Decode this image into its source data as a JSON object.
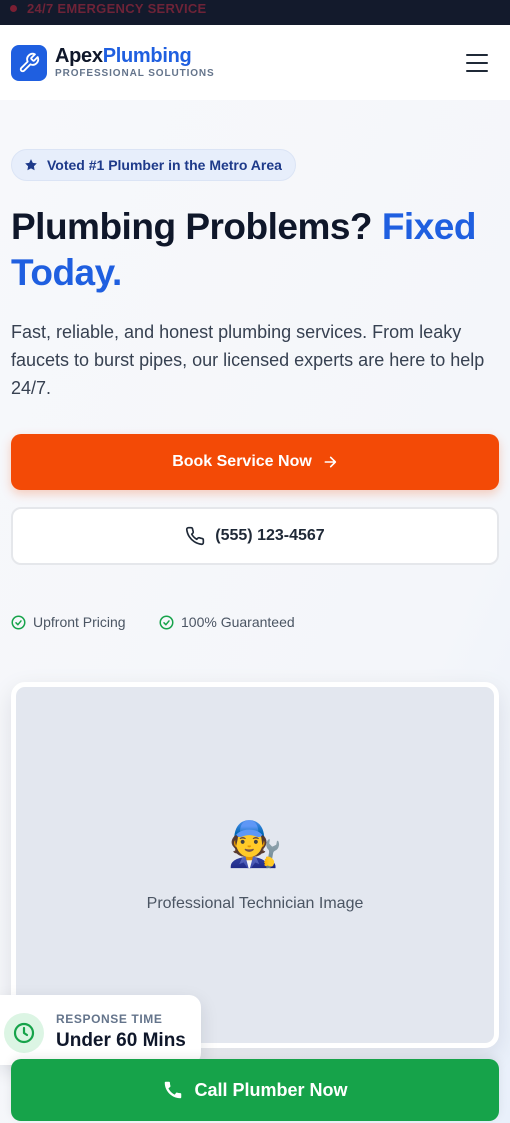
{
  "topbar": {
    "text": "24/7 EMERGENCY SERVICE"
  },
  "header": {
    "brand_part1": "Apex",
    "brand_part2": "Plumbing",
    "tagline": "PROFESSIONAL SOLUTIONS",
    "logo_icon": "wrench-icon",
    "menu_icon": "hamburger-menu-icon"
  },
  "hero": {
    "badge": "Voted #1 Plumber in the Metro Area",
    "title_part1": "Plumbing Problems?",
    "title_part2": "Fixed Today.",
    "lead": "Fast, reliable, and honest plumbing services. From leaky faucets to burst pipes, our licensed experts are here to help 24/7.",
    "primary_button": "Book Service Now",
    "secondary_button": "(555) 123-4567",
    "trust_items": [
      "Upfront Pricing",
      "100% Guaranteed"
    ]
  },
  "image_card": {
    "emoji": "🧑‍🔧",
    "caption": "Professional Technician Image"
  },
  "response": {
    "label": "RESPONSE TIME",
    "value": "Under 60 Mins"
  },
  "cta": {
    "label": "Call Plumber Now"
  },
  "colors": {
    "brand_blue": "#1f5fe0",
    "orange": "#f34a06",
    "green": "#16a34a",
    "dark": "#131a2c"
  }
}
